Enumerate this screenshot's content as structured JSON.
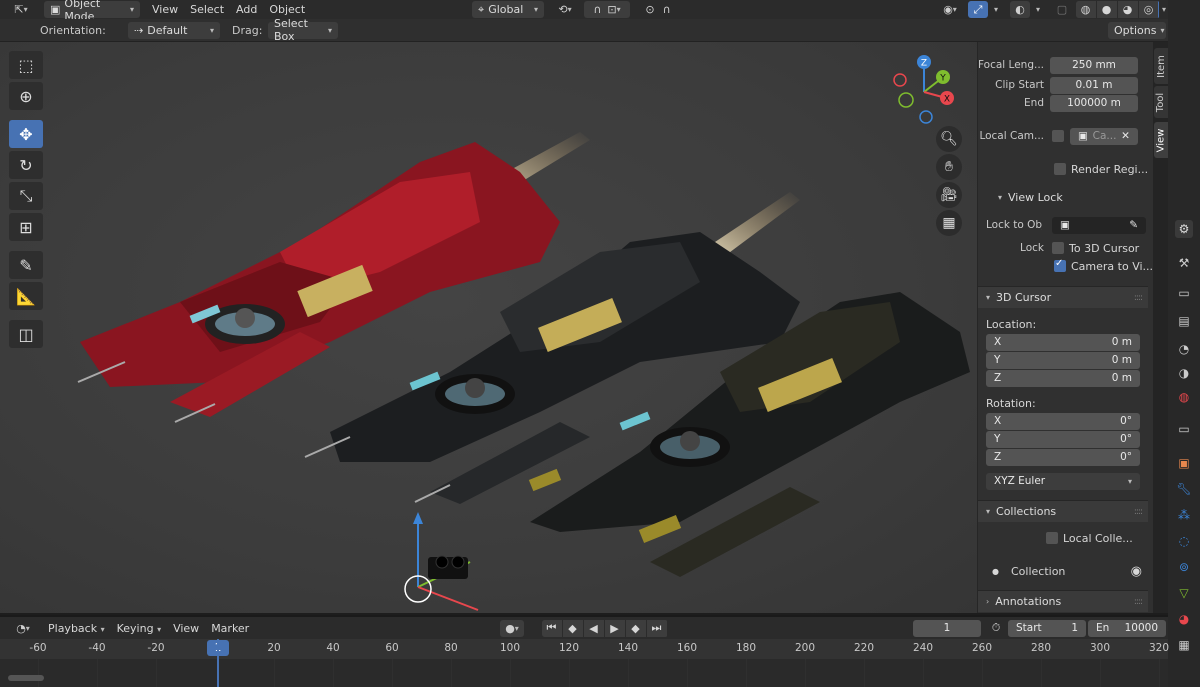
{
  "header": {
    "mode_label": "Object Mode",
    "menus": [
      "View",
      "Select",
      "Add",
      "Object"
    ],
    "transform_orientation": "Global",
    "options_label": "Options"
  },
  "tool_header": {
    "orientation_label": "Orientation:",
    "orientation_value": "Default",
    "drag_label": "Drag:",
    "drag_value": "Select Box"
  },
  "toolbar": {
    "tools": [
      "select-box",
      "cursor",
      "move",
      "rotate",
      "scale",
      "transform",
      "annotate",
      "measure",
      "add-cube"
    ],
    "active": "move"
  },
  "gizmo": {
    "x": "X",
    "y": "Y",
    "z": "Z"
  },
  "sidebar": {
    "tabs": [
      "Item",
      "Tool",
      "View"
    ],
    "active_tab": "View",
    "view": {
      "focal_length_label": "Focal Leng...",
      "focal_length_value": "250 mm",
      "clip_start_label": "Clip Start",
      "clip_start_value": "0.01 m",
      "clip_end_label": "End",
      "clip_end_value": "100000 m",
      "local_camera_label": "Local Cam...",
      "local_camera_placeholder": "Ca...",
      "render_region_label": "Render Regi..."
    },
    "view_lock": {
      "title": "View Lock",
      "lock_to_obj_label": "Lock to Obj",
      "lock_label": "Lock",
      "to_3d_cursor_label": "To 3D Cursor",
      "camera_to_view_label": "Camera to Vi..."
    },
    "cursor": {
      "title": "3D Cursor",
      "location_label": "Location:",
      "location": [
        {
          "axis": "X",
          "value": "0 m"
        },
        {
          "axis": "Y",
          "value": "0 m"
        },
        {
          "axis": "Z",
          "value": "0 m"
        }
      ],
      "rotation_label": "Rotation:",
      "rotation": [
        {
          "axis": "X",
          "value": "0°"
        },
        {
          "axis": "Y",
          "value": "0°"
        },
        {
          "axis": "Z",
          "value": "0°"
        }
      ],
      "rotation_mode": "XYZ Euler"
    },
    "collections": {
      "title": "Collections",
      "local_collections_label": "Local Colle...",
      "item": "Collection"
    },
    "annotations": {
      "title": "Annotations"
    }
  },
  "timeline": {
    "menus": [
      "Playback",
      "Keying",
      "View",
      "Marker"
    ],
    "current_frame": "1",
    "start_label": "Start",
    "start_value": "1",
    "end_label": "En",
    "end_value": "10000",
    "ruler": [
      "-60",
      "-40",
      "-20",
      "1",
      "20",
      "40",
      "60",
      "80",
      "100",
      "120",
      "140",
      "160",
      "180",
      "200",
      "220",
      "240",
      "260",
      "280",
      "300",
      "320"
    ]
  },
  "colors": {
    "accent": "#4772b3",
    "axis_x": "#e8474d",
    "axis_y": "#7fbd2e",
    "axis_z": "#3c85d8"
  }
}
